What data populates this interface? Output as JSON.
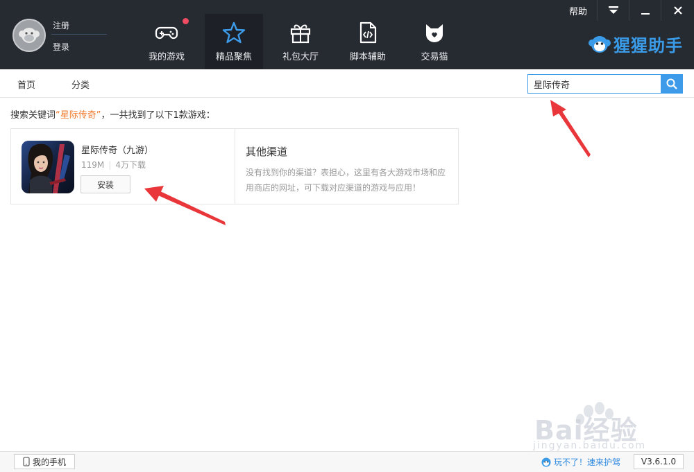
{
  "header": {
    "auth": {
      "register": "注册",
      "login": "登录"
    },
    "nav": [
      {
        "label": "我的游戏",
        "icon": "gamepad-icon",
        "badge": true
      },
      {
        "label": "精品聚焦",
        "icon": "star-icon",
        "active": true
      },
      {
        "label": "礼包大厅",
        "icon": "gift-icon"
      },
      {
        "label": "脚本辅助",
        "icon": "script-file-icon"
      },
      {
        "label": "交易猫",
        "icon": "cat-icon"
      }
    ],
    "window_controls": {
      "help": "帮助",
      "menu": "menu-dropdown-icon",
      "minimize": "minimize-icon",
      "close": "close-icon"
    },
    "brand": "猩猩助手"
  },
  "subnav": {
    "home": "首页",
    "category": "分类"
  },
  "search": {
    "value": "星际传奇"
  },
  "results": {
    "prefix": "搜索关键词",
    "keyword": "“星际传奇”",
    "suffix": "，一共找到了以下1款游戏："
  },
  "game": {
    "title": "星际传奇（九游）",
    "size": "119M",
    "downloads": "4万下载",
    "install_label": "安装"
  },
  "other_channels": {
    "title": "其他渠道",
    "description": "没有找到你的渠道？表担心，这里有各大游戏市场和应用商店的网址，可下载对应渠道的游戏与应用！"
  },
  "footer": {
    "my_phone": "我的手机",
    "help_link": "玩不了！速来护驾",
    "version": "V3.6.1.0"
  },
  "watermark": {
    "brand": "Bai经验",
    "url": "jingyan.baidu.com"
  },
  "colors": {
    "header_bg": "#262a31",
    "accent": "#3d9be9",
    "keyword": "#f07a2d",
    "badge": "#ef4b62"
  }
}
